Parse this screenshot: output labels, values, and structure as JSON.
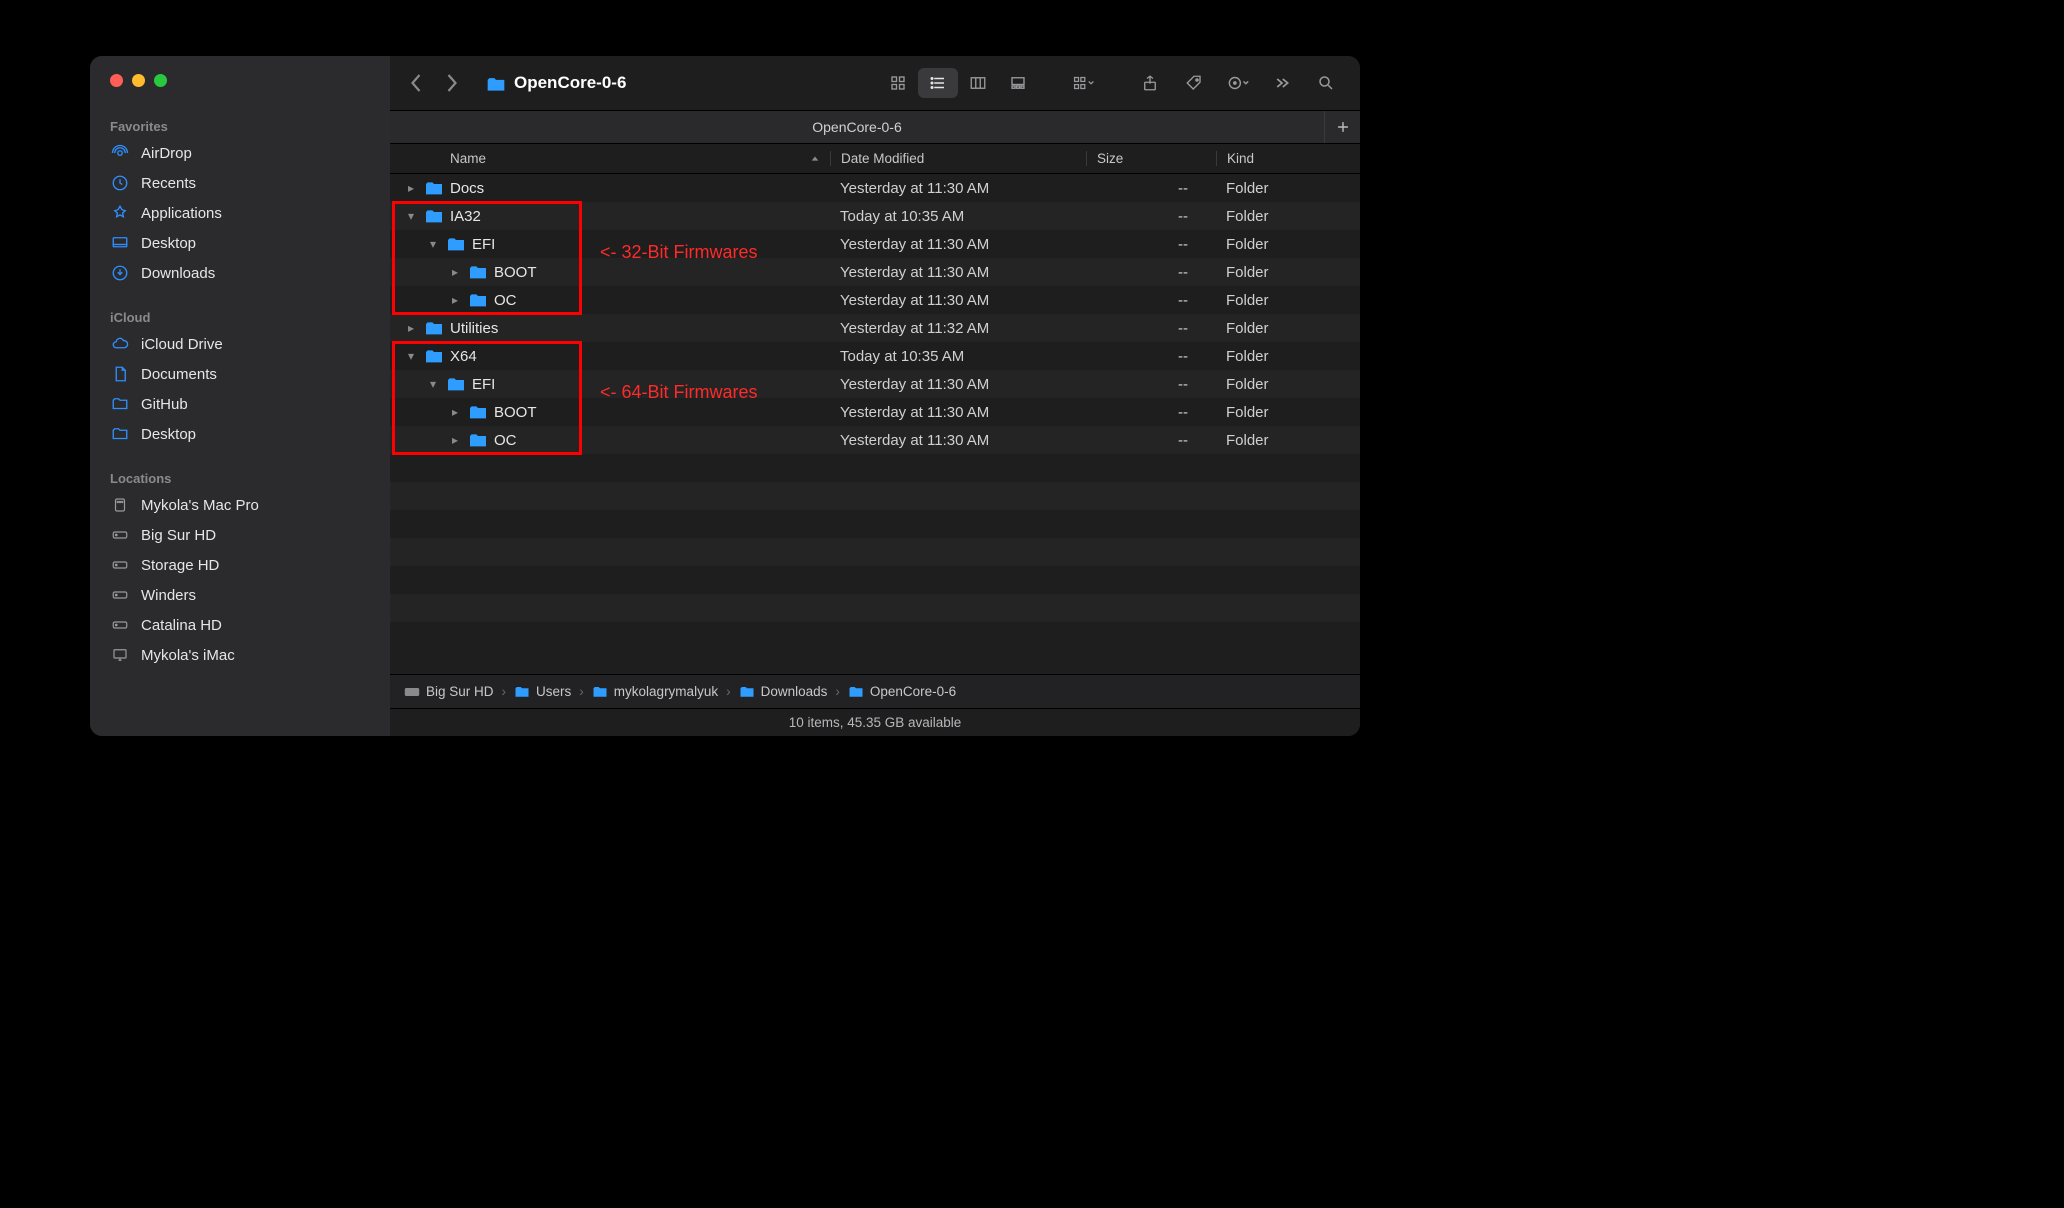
{
  "window_title": "OpenCore-0-6",
  "tab_title": "OpenCore-0-6",
  "traffic": {
    "close": "#ff5f57",
    "min": "#febc2e",
    "max": "#28c840"
  },
  "sidebar": {
    "sections": [
      {
        "label": "Favorites",
        "items": [
          {
            "icon": "airdrop-icon",
            "label": "AirDrop"
          },
          {
            "icon": "clock-icon",
            "label": "Recents"
          },
          {
            "icon": "apps-icon",
            "label": "Applications"
          },
          {
            "icon": "desktop-icon",
            "label": "Desktop"
          },
          {
            "icon": "download-icon",
            "label": "Downloads"
          }
        ]
      },
      {
        "label": "iCloud",
        "items": [
          {
            "icon": "cloud-icon",
            "label": "iCloud Drive"
          },
          {
            "icon": "document-icon",
            "label": "Documents"
          },
          {
            "icon": "folder-icon",
            "label": "GitHub"
          },
          {
            "icon": "folder-icon",
            "label": "Desktop"
          }
        ]
      },
      {
        "label": "Locations",
        "items": [
          {
            "icon": "macpro-icon",
            "label": "Mykola's Mac Pro"
          },
          {
            "icon": "disk-icon",
            "label": "Big Sur HD"
          },
          {
            "icon": "disk-icon",
            "label": "Storage HD"
          },
          {
            "icon": "disk-icon",
            "label": "Winders"
          },
          {
            "icon": "disk-icon",
            "label": "Catalina HD"
          },
          {
            "icon": "imac-icon",
            "label": "Mykola's iMac"
          }
        ]
      }
    ]
  },
  "columns": {
    "name": "Name",
    "date": "Date Modified",
    "size": "Size",
    "kind": "Kind"
  },
  "rows": [
    {
      "indent": 0,
      "disc": "right",
      "name": "Docs",
      "date": "Yesterday at 11:30 AM",
      "size": "--",
      "kind": "Folder"
    },
    {
      "indent": 0,
      "disc": "down",
      "name": "IA32",
      "date": "Today at 10:35 AM",
      "size": "--",
      "kind": "Folder"
    },
    {
      "indent": 1,
      "disc": "down",
      "name": "EFI",
      "date": "Yesterday at 11:30 AM",
      "size": "--",
      "kind": "Folder"
    },
    {
      "indent": 2,
      "disc": "right",
      "name": "BOOT",
      "date": "Yesterday at 11:30 AM",
      "size": "--",
      "kind": "Folder"
    },
    {
      "indent": 2,
      "disc": "right",
      "name": "OC",
      "date": "Yesterday at 11:30 AM",
      "size": "--",
      "kind": "Folder"
    },
    {
      "indent": 0,
      "disc": "right",
      "name": "Utilities",
      "date": "Yesterday at 11:32 AM",
      "size": "--",
      "kind": "Folder"
    },
    {
      "indent": 0,
      "disc": "down",
      "name": "X64",
      "date": "Today at 10:35 AM",
      "size": "--",
      "kind": "Folder"
    },
    {
      "indent": 1,
      "disc": "down",
      "name": "EFI",
      "date": "Yesterday at 11:30 AM",
      "size": "--",
      "kind": "Folder"
    },
    {
      "indent": 2,
      "disc": "right",
      "name": "BOOT",
      "date": "Yesterday at 11:30 AM",
      "size": "--",
      "kind": "Folder"
    },
    {
      "indent": 2,
      "disc": "right",
      "name": "OC",
      "date": "Yesterday at 11:30 AM",
      "size": "--",
      "kind": "Folder"
    }
  ],
  "annotations": {
    "box1": {
      "label": "<- 32-Bit Firmwares"
    },
    "box2": {
      "label": "<- 64-Bit Firmwares"
    }
  },
  "pathbar": [
    {
      "icon": "hdd",
      "label": "Big Sur HD"
    },
    {
      "icon": "folder-blue",
      "label": "Users"
    },
    {
      "icon": "folder-blue",
      "label": "mykolagrymalyuk"
    },
    {
      "icon": "folder-blue",
      "label": "Downloads"
    },
    {
      "icon": "folder-blue",
      "label": "OpenCore-0-6"
    }
  ],
  "statusbar": "10 items, 45.35 GB available"
}
